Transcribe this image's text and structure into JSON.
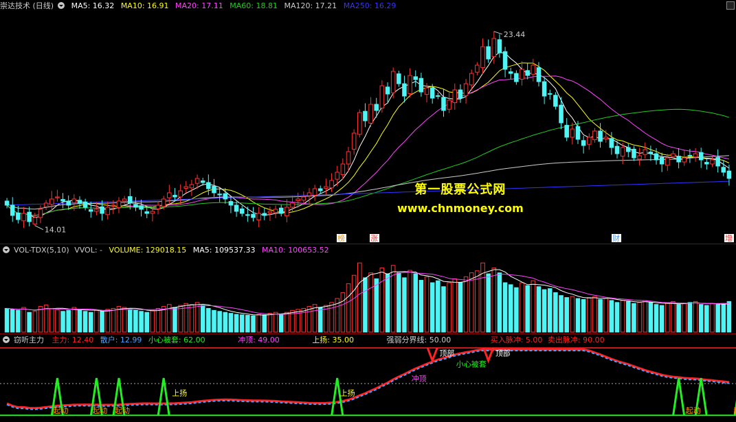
{
  "colors": {
    "up": "#ff3333",
    "down": "#4ff5f5",
    "ma5": "#ffffff",
    "ma10": "#ffff00",
    "ma20": "#ff44ff",
    "ma60": "#22cc22",
    "ma120": "#cccccc",
    "ma250": "#3333ff",
    "vol_ma5": "#ffffff",
    "vol_ma10": "#ff44ff",
    "zhuli": "#ff2222",
    "sanhu": "#4aa0ff",
    "signal": "#22ee22",
    "text": "#cccccc"
  },
  "kline_header": {
    "title": "崇达技术 (日线)",
    "ma5": "MA5: 16.32",
    "ma10": "MA10: 16.91",
    "ma20": "MA20: 17.11",
    "ma60": "MA60: 18.81",
    "ma120": "MA120: 17.21",
    "ma250": "MA250: 16.29"
  },
  "kline": {
    "high_label": "23.44",
    "low_label": "14.01",
    "price_min": 13.6,
    "price_max": 24.1,
    "high_value": 23.44,
    "low_value": 14.01,
    "closes": [
      15.0,
      14.5,
      14.3,
      14.6,
      14.2,
      14.4,
      14.8,
      15.1,
      15.3,
      15.4,
      15.2,
      15.0,
      15.3,
      15.1,
      14.9,
      14.7,
      14.8,
      14.6,
      14.9,
      15.0,
      15.2,
      15.3,
      15.1,
      14.9,
      14.8,
      14.6,
      14.7,
      15.0,
      15.3,
      15.6,
      15.4,
      15.7,
      15.9,
      16.0,
      16.3,
      16.1,
      15.8,
      15.6,
      15.5,
      15.3,
      15.0,
      14.7,
      14.6,
      14.5,
      14.4,
      14.6,
      14.5,
      14.7,
      14.8,
      14.6,
      14.9,
      15.1,
      15.3,
      15.4,
      15.6,
      15.8,
      15.7,
      15.9,
      16.2,
      16.6,
      17.0,
      17.6,
      18.5,
      19.5,
      19.1,
      19.9,
      19.6,
      20.8,
      20.4,
      21.5,
      20.9,
      20.3,
      21.3,
      21.1,
      20.5,
      20.7,
      20.2,
      20.3,
      19.6,
      20.1,
      20.6,
      20.2,
      20.9,
      21.4,
      21.8,
      22.7,
      22.1,
      23.1,
      22.4,
      21.6,
      21.4,
      21.0,
      21.6,
      21.3,
      21.8,
      21.0,
      20.3,
      20.4,
      19.8,
      19.0,
      18.3,
      18.7,
      18.2,
      17.9,
      18.3,
      18.6,
      18.1,
      18.3,
      17.8,
      17.5,
      17.8,
      17.6,
      17.3,
      17.4,
      17.7,
      17.5,
      17.2,
      17.0,
      17.3,
      17.5,
      17.1,
      17.3,
      17.4,
      17.5,
      17.2,
      17.0,
      17.2,
      16.9,
      16.6,
      16.3
    ]
  },
  "tags": [
    "榜",
    "涨",
    "财",
    "增"
  ],
  "volume_header": {
    "title": "VOL-TDX(5,10)",
    "vvol": "VVOL: -",
    "volume": "VOLUME: 129018.15",
    "ma5": "MA5: 109537.33",
    "ma10": "MA10: 100653.52"
  },
  "volumes": [
    48,
    46,
    44,
    50,
    40,
    42,
    52,
    55,
    48,
    45,
    42,
    44,
    50,
    46,
    42,
    40,
    44,
    42,
    46,
    48,
    52,
    50,
    46,
    44,
    42,
    40,
    44,
    48,
    52,
    56,
    50,
    54,
    58,
    56,
    60,
    54,
    48,
    44,
    42,
    40,
    38,
    36,
    35,
    34,
    33,
    36,
    35,
    38,
    40,
    36,
    40,
    44,
    46,
    48,
    52,
    56,
    50,
    54,
    60,
    68,
    80,
    98,
    115,
    140,
    110,
    120,
    108,
    130,
    118,
    135,
    120,
    110,
    125,
    118,
    105,
    112,
    100,
    104,
    92,
    100,
    108,
    100,
    112,
    120,
    124,
    140,
    118,
    130,
    120,
    100,
    96,
    90,
    100,
    94,
    104,
    92,
    86,
    88,
    80,
    74,
    70,
    72,
    68,
    66,
    70,
    72,
    66,
    68,
    64,
    60,
    64,
    62,
    58,
    60,
    64,
    60,
    56,
    54,
    58,
    62,
    56,
    58,
    60,
    62,
    56,
    54,
    58,
    56,
    58,
    62
  ],
  "indicator_header": {
    "title": "窃听主力",
    "zhuli": "主力: 12.40",
    "sanhu": "散户: 12.99",
    "xiaoxin": "小心被套: 62.00",
    "chongding": "冲顶: 49.00",
    "shangyang": "上扬: 35.00",
    "fenjie": "强弱分界线: 50.00",
    "buy": "买入脉冲: 5.00",
    "sell": "卖出脉冲: 90.00"
  },
  "indicator_labels": {
    "qidong": "起动",
    "shangyang": "上扬",
    "chongding": "冲顶",
    "xiaoxin": "小心被套",
    "dingbu": "顶部"
  },
  "watermark": {
    "line1": "第一股票公式网",
    "line2": "www.chnmoney.com"
  }
}
